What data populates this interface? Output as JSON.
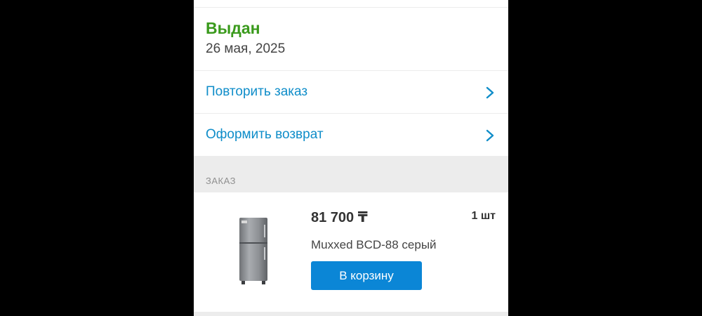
{
  "colors": {
    "status_green": "#3a9a1c",
    "link_blue": "#0f8dc9",
    "button_blue": "#0b86d6",
    "section_gray": "#ececec"
  },
  "order_status": {
    "label": "Выдан",
    "date": "26 мая, 2025"
  },
  "actions": [
    {
      "label": "Повторить заказ",
      "icon": "chevron-right-icon"
    },
    {
      "label": "Оформить возврат",
      "icon": "chevron-right-icon"
    }
  ],
  "order_section": {
    "title": "ЗАКАЗ",
    "items": [
      {
        "price": "81 700 ₸",
        "quantity": "1 шт",
        "name": "Muxxed BCD-88 серый",
        "image": "refrigerator-image",
        "button_label": "В корзину"
      }
    ]
  }
}
